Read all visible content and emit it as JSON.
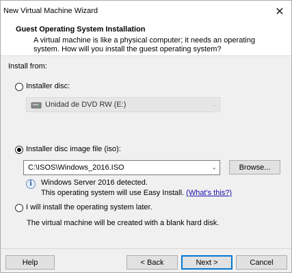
{
  "window": {
    "title": "New Virtual Machine Wizard",
    "close_glyph": "✕"
  },
  "header": {
    "title": "Guest Operating System Installation",
    "description": "A virtual machine is like a physical computer; it needs an operating system. How will you install the guest operating system?"
  },
  "install_from": {
    "label": "Install from:",
    "options": [
      {
        "label": "Installer disc:",
        "selected": false,
        "dropdown_value": "Unidad de DVD RW (E:)",
        "icon": "dvd-drive-icon"
      },
      {
        "label": "Installer disc image file (iso):",
        "selected": true,
        "path_value": "C:\\ISOS\\Windows_2016.ISO",
        "browse_label": "Browse...",
        "detected_line1": "Windows Server 2016 detected.",
        "detected_line2": "This operating system will use Easy Install.",
        "link_text": "(What's this?)",
        "icon": "info-icon"
      },
      {
        "label": "I will install the operating system later.",
        "selected": false,
        "note": "The virtual machine will be created with a blank hard disk."
      }
    ]
  },
  "footer": {
    "help_label": "Help",
    "back_label": "< Back",
    "next_label": "Next >",
    "cancel_label": "Cancel"
  },
  "colors": {
    "link": "#1a0dab",
    "default_button_border": "#0078d7",
    "dialog_background": "#f0f0f0"
  }
}
